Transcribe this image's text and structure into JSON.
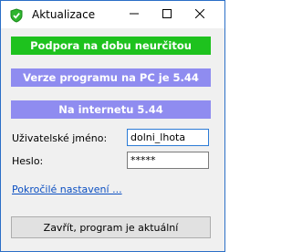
{
  "window": {
    "title": "Aktualizace",
    "icon": "check-shield-icon",
    "controls": {
      "minimize": "minimize-icon",
      "maximize": "maximize-icon",
      "close": "close-icon"
    }
  },
  "status": {
    "support": "Podpora na dobu neurčitou",
    "local_version": "Verze programu na PC je 5.44",
    "online_version": "Na internetu 5.44"
  },
  "form": {
    "username_label": "Uživatelské jméno:",
    "username_value": "dolni_lhota",
    "password_label": "Heslo:",
    "password_value": "*****"
  },
  "advanced_link": "Pokročilé nastavení ...",
  "close_button": "Zavřít, program je aktuální",
  "colors": {
    "support_green": "#1ec21e",
    "version_purple": "#8f8cf0",
    "link_blue": "#0b4fc2",
    "window_border": "#2b6fc7"
  }
}
